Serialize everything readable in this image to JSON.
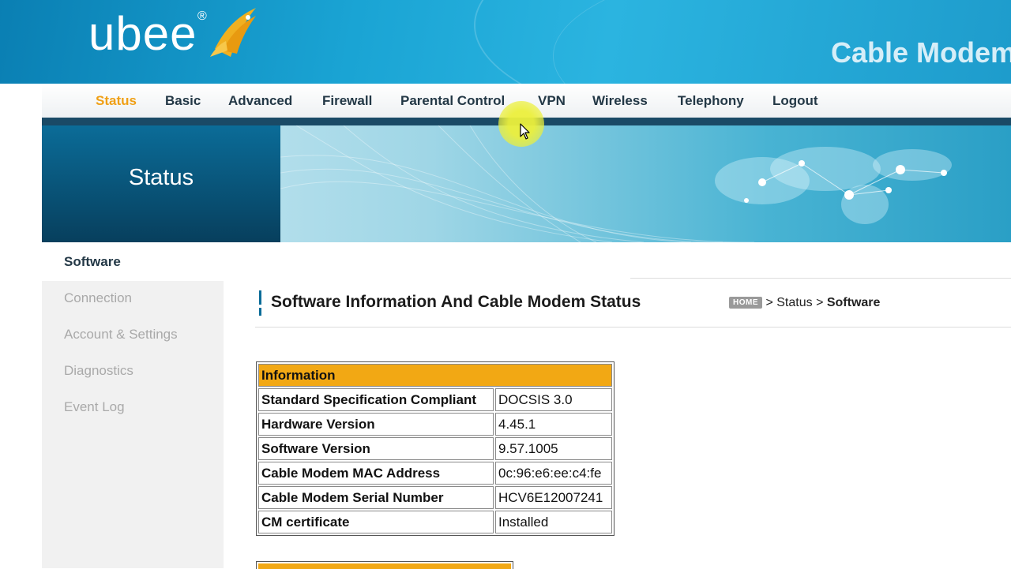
{
  "header": {
    "logo_text": "ubee",
    "logo_reg": "®",
    "banner_title": "Cable Modem"
  },
  "nav": {
    "items": [
      {
        "label": "Status",
        "active": true
      },
      {
        "label": "Basic"
      },
      {
        "label": "Advanced"
      },
      {
        "label": "Firewall"
      },
      {
        "label": "Parental Control"
      },
      {
        "label": "VPN"
      },
      {
        "label": "Wireless"
      },
      {
        "label": "Telephony"
      },
      {
        "label": "Logout"
      }
    ]
  },
  "banner": {
    "section_title": "Status"
  },
  "sidebar": {
    "items": [
      {
        "label": "Software",
        "active": true
      },
      {
        "label": "Connection"
      },
      {
        "label": "Account & Settings"
      },
      {
        "label": "Diagnostics"
      },
      {
        "label": "Event Log"
      }
    ]
  },
  "main": {
    "page_title": "Software Information And Cable Modem Status",
    "breadcrumb": {
      "home": "HOME",
      "sep": ">",
      "level1": "Status",
      "current": "Software"
    },
    "info_table": {
      "header": "Information",
      "rows": [
        {
          "label": "Standard Specification Compliant",
          "value": "DOCSIS 3.0"
        },
        {
          "label": "Hardware Version",
          "value": "4.45.1"
        },
        {
          "label": "Software Version",
          "value": "9.57.1005"
        },
        {
          "label": "Cable Modem MAC Address",
          "value": "0c:96:e6:ee:c4:fe"
        },
        {
          "label": "Cable Modem Serial Number",
          "value": "HCV6E12007241"
        },
        {
          "label": "CM certificate",
          "value": "Installed"
        }
      ]
    }
  },
  "colors": {
    "accent": "#f2a814",
    "nav_active": "#f0a016",
    "brand_dark": "#0b6c98"
  },
  "icons": {
    "logo": "fish-logo-icon",
    "cursor": "mouse-pointer-icon"
  }
}
